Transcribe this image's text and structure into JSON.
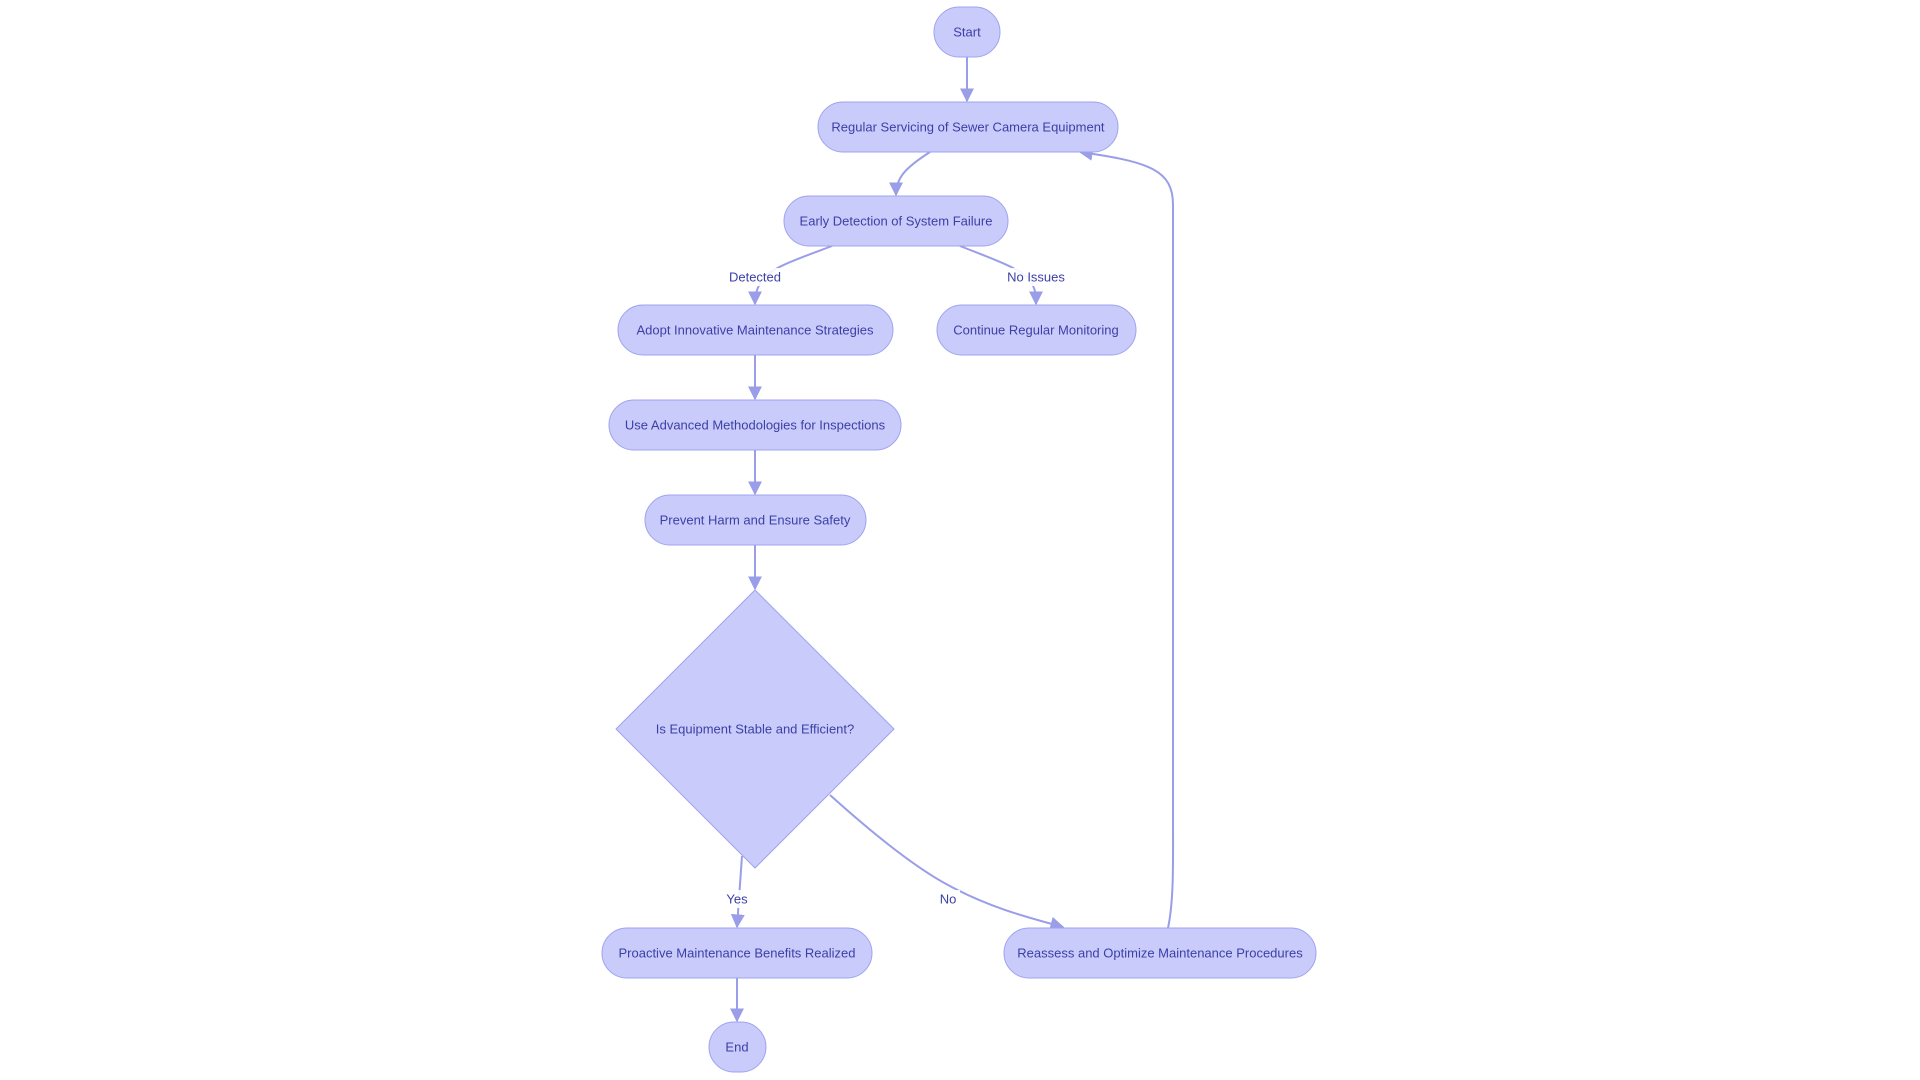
{
  "diagram": {
    "type": "flowchart",
    "colors": {
      "node_fill": "#c9cbfb",
      "node_stroke": "#9fa3ee",
      "text": "#3c3fa6",
      "edge": "#9a9de8",
      "background": "#ffffff"
    },
    "nodes": [
      {
        "id": "start",
        "label": "Start",
        "shape": "rounded"
      },
      {
        "id": "servicing",
        "label": "Regular Servicing of Sewer Camera Equipment",
        "shape": "rounded"
      },
      {
        "id": "detection",
        "label": "Early Detection of System Failure",
        "shape": "rounded"
      },
      {
        "id": "adopt",
        "label": "Adopt Innovative Maintenance Strategies",
        "shape": "rounded"
      },
      {
        "id": "monitor",
        "label": "Continue Regular Monitoring",
        "shape": "rounded"
      },
      {
        "id": "advanced",
        "label": "Use Advanced Methodologies for Inspections",
        "shape": "rounded"
      },
      {
        "id": "prevent",
        "label": "Prevent Harm and Ensure Safety",
        "shape": "rounded"
      },
      {
        "id": "decision",
        "label": "Is Equipment Stable and Efficient?",
        "shape": "diamond"
      },
      {
        "id": "benefits",
        "label": "Proactive Maintenance Benefits Realized",
        "shape": "rounded"
      },
      {
        "id": "reassess",
        "label": "Reassess and Optimize Maintenance Procedures",
        "shape": "rounded"
      },
      {
        "id": "end",
        "label": "End",
        "shape": "rounded"
      }
    ],
    "edges": [
      {
        "from": "start",
        "to": "servicing",
        "label": ""
      },
      {
        "from": "servicing",
        "to": "detection",
        "label": ""
      },
      {
        "from": "detection",
        "to": "adopt",
        "label": "Detected"
      },
      {
        "from": "detection",
        "to": "monitor",
        "label": "No Issues"
      },
      {
        "from": "adopt",
        "to": "advanced",
        "label": ""
      },
      {
        "from": "advanced",
        "to": "prevent",
        "label": ""
      },
      {
        "from": "prevent",
        "to": "decision",
        "label": ""
      },
      {
        "from": "decision",
        "to": "benefits",
        "label": "Yes"
      },
      {
        "from": "decision",
        "to": "reassess",
        "label": "No"
      },
      {
        "from": "benefits",
        "to": "end",
        "label": ""
      },
      {
        "from": "reassess",
        "to": "servicing",
        "label": ""
      }
    ]
  }
}
